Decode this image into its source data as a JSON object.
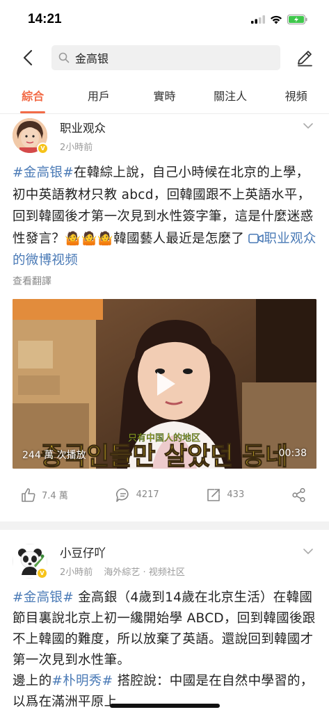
{
  "status": {
    "time": "14:21"
  },
  "search": {
    "query": "金高银"
  },
  "tabs": [
    "綜合",
    "用戶",
    "實時",
    "關注人",
    "視頻"
  ],
  "post1": {
    "author": "职业观众",
    "time": "2小時前",
    "hashtag": "#金高银#",
    "text": "在韓綜上說，自己小時候在北京的上學，初中英語教材只教 abcd，回韓國跟不上英語水平，回到韓國後才第一次見到水性簽字筆，這是什麼迷惑性發言？",
    "emoji": "🤷🤷🤷",
    "text_end": "韓國藝人最近是怎麼了",
    "video_link": "职业观众的微博视频",
    "translate": "查看翻譯",
    "video": {
      "views": "244 萬 次播放",
      "duration": "00:38",
      "caption_ko": "중국인들만 살았던 동네",
      "caption_zh": "只有中国人的地区"
    },
    "actions": {
      "likes": "7.4 萬",
      "comments": "4217",
      "reposts": "433"
    }
  },
  "post2": {
    "author": "小豆仔吖",
    "time": "2小時前",
    "source": "海外綜艺 · 视频社区",
    "hashtag1": "#金高银#",
    "text1": " 金高銀（4歲到14歲在北京生活）在韓國節目裏說北京上初一纔開始學 ABCD，回到韓國後跟不上韓國的難度，所以放棄了英語。還說回到韓國才第一次見到水性筆。",
    "text2": "邊上的",
    "hashtag2": "#朴明秀#",
    "text3": " 搭腔說：中國是在自然中學習的，以爲在滿洲平原上"
  }
}
